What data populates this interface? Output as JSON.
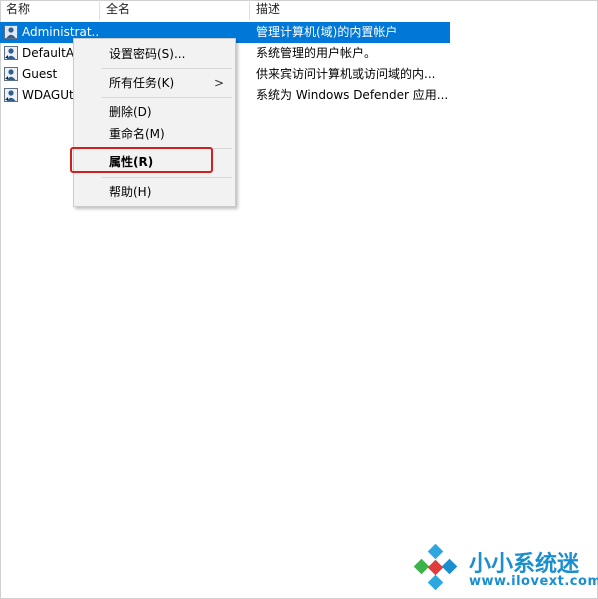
{
  "columns": {
    "name": "名称",
    "full_name": "全名",
    "description": "描述"
  },
  "users": [
    {
      "name": "Administrat...",
      "full_name": "",
      "description": "管理计算机(域)的内置帐户",
      "selected": true
    },
    {
      "name": "DefaultAc",
      "full_name": "",
      "description": "系统管理的用户帐户。",
      "selected": false
    },
    {
      "name": "Guest",
      "full_name": "",
      "description": "供来宾访问计算机或访问域的内...",
      "selected": false
    },
    {
      "name": "WDAGUt",
      "full_name": "",
      "description": "系统为 Windows Defender 应用...",
      "selected": false
    }
  ],
  "context_menu": {
    "set_password": "设置密码(S)...",
    "all_tasks": "所有任务(K)",
    "all_tasks_arrow": ">",
    "delete": "删除(D)",
    "rename": "重命名(M)",
    "properties": "属性(R)",
    "help": "帮助(H)"
  },
  "watermark": {
    "text": "小小系统迷",
    "url": "www.ilovext.com"
  },
  "colors": {
    "selection": "#0078d7",
    "highlight_box": "#d22020",
    "watermark": "#1b8ecf"
  },
  "icons": {
    "user": "user-icon",
    "logo": "diamond-logo-icon"
  }
}
